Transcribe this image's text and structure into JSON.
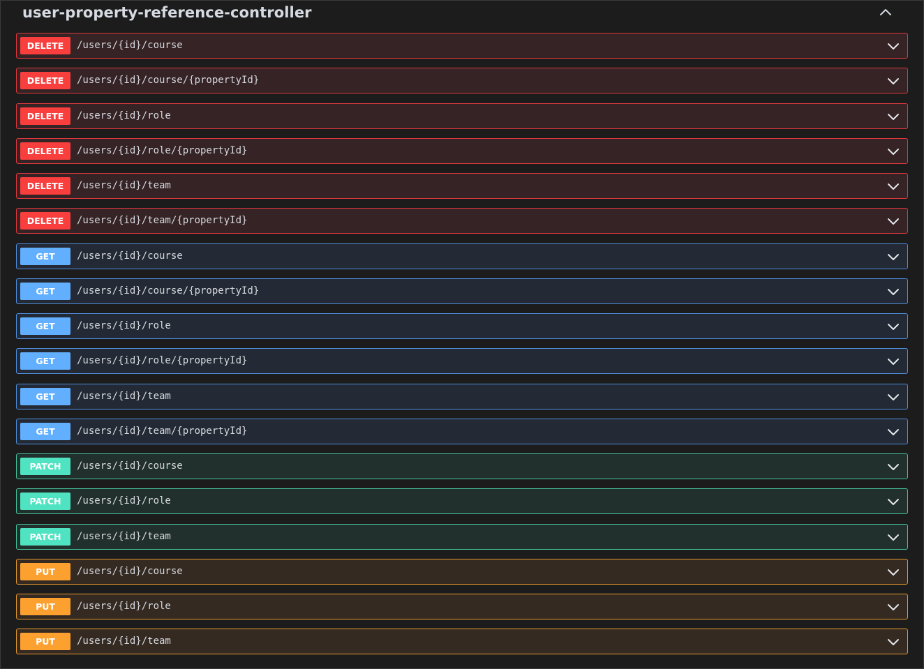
{
  "section": {
    "title": "user-property-reference-controller",
    "toggle_icon": "chevron-up-icon"
  },
  "colors": {
    "DELETE": "#f93e3e",
    "GET": "#61affe",
    "PATCH": "#50e3c2",
    "PUT": "#fca130"
  },
  "operations": [
    {
      "method": "DELETE",
      "path": "/users/{id}/course"
    },
    {
      "method": "DELETE",
      "path": "/users/{id}/course/{propertyId}"
    },
    {
      "method": "DELETE",
      "path": "/users/{id}/role"
    },
    {
      "method": "DELETE",
      "path": "/users/{id}/role/{propertyId}"
    },
    {
      "method": "DELETE",
      "path": "/users/{id}/team"
    },
    {
      "method": "DELETE",
      "path": "/users/{id}/team/{propertyId}"
    },
    {
      "method": "GET",
      "path": "/users/{id}/course"
    },
    {
      "method": "GET",
      "path": "/users/{id}/course/{propertyId}"
    },
    {
      "method": "GET",
      "path": "/users/{id}/role"
    },
    {
      "method": "GET",
      "path": "/users/{id}/role/{propertyId}"
    },
    {
      "method": "GET",
      "path": "/users/{id}/team"
    },
    {
      "method": "GET",
      "path": "/users/{id}/team/{propertyId}"
    },
    {
      "method": "PATCH",
      "path": "/users/{id}/course"
    },
    {
      "method": "PATCH",
      "path": "/users/{id}/role"
    },
    {
      "method": "PATCH",
      "path": "/users/{id}/team"
    },
    {
      "method": "PUT",
      "path": "/users/{id}/course"
    },
    {
      "method": "PUT",
      "path": "/users/{id}/role"
    },
    {
      "method": "PUT",
      "path": "/users/{id}/team"
    }
  ]
}
